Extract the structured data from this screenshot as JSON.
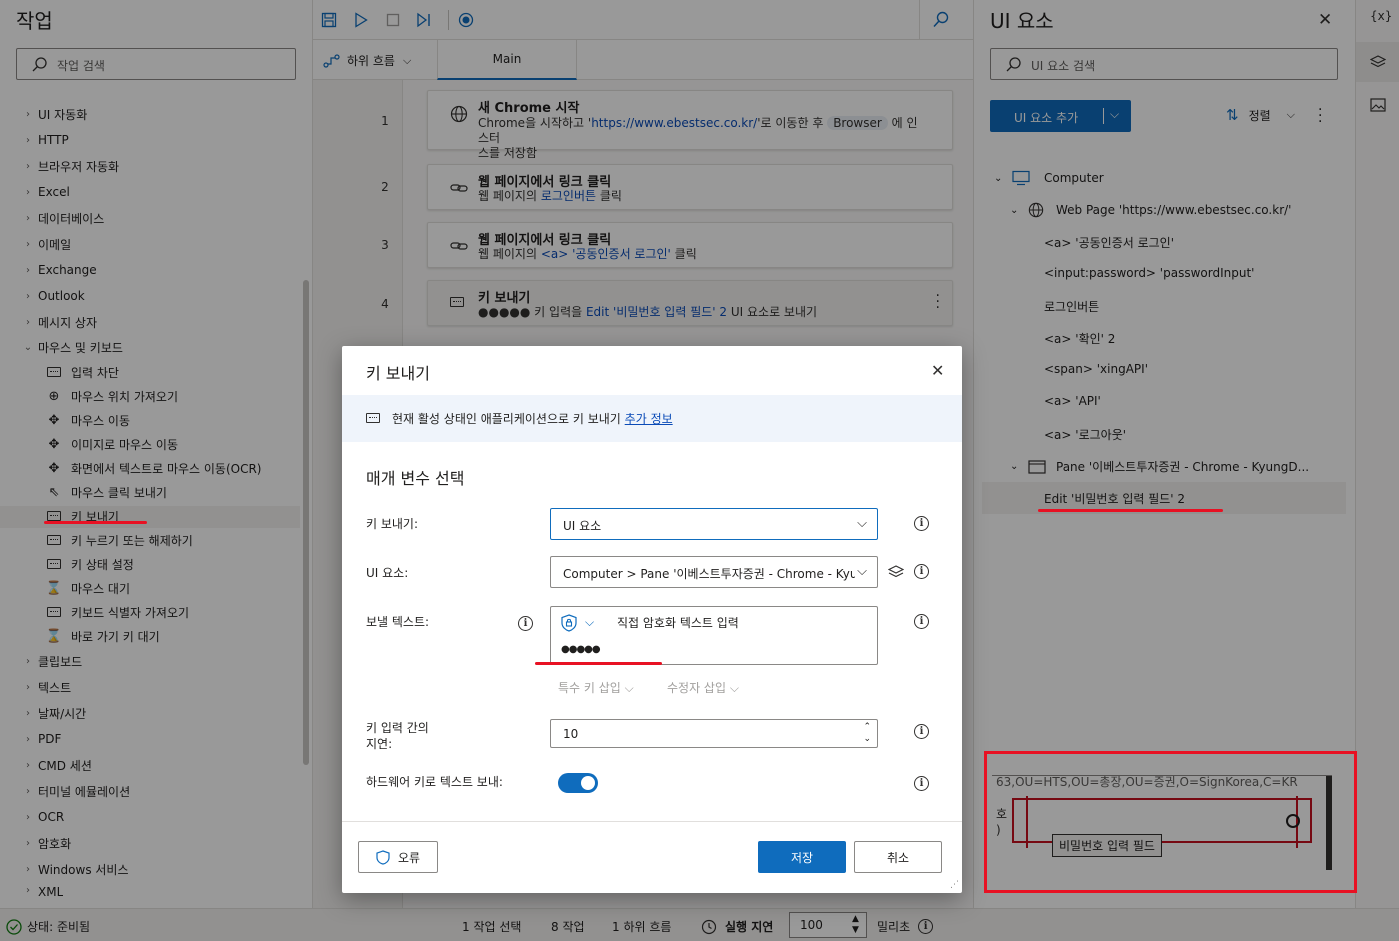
{
  "left_panel": {
    "title": "작업",
    "search_placeholder": "작업 검색",
    "categories_top": [
      "UI 자동화",
      "HTTP",
      "브라우저 자동화",
      "Excel",
      "데이터베이스",
      "이메일",
      "Exchange",
      "Outlook",
      "메시지 상자"
    ],
    "expanded_category": "마우스 및 키보드",
    "sub_items": [
      "입력 차단",
      "마우스 위치 가져오기",
      "마우스 이동",
      "이미지로 마우스 이동",
      "화면에서 텍스트로 마우스 이동(OCR)",
      "마우스 클릭 보내기",
      "키 보내기",
      "키 누르기 또는 해제하기",
      "키 상태 설정",
      "마우스 대기",
      "키보드 식별자 가져오기",
      "바로 가기 키 대기"
    ],
    "categories_bottom": [
      "클립보드",
      "텍스트",
      "날짜/시간",
      "PDF",
      "CMD 세션",
      "터미널 에뮬레이션",
      "OCR",
      "암호화",
      "Windows 서비스",
      "XML"
    ]
  },
  "tabs": {
    "subflow_label": "하위 흐름",
    "main_tab": "Main"
  },
  "actions": [
    {
      "num": "1",
      "title": "새 Chrome 시작",
      "d1": "Chrome을 시작하고 '",
      "url": "https://www.ebestsec.co.kr/",
      "d2": "'로 이동한 후 ",
      "var": "Browser",
      "d3": " 에 인스터",
      "d4": "스를 저장함"
    },
    {
      "num": "2",
      "title": "웹 페이지에서 링크 클릭",
      "d1": "웹 페이지의 ",
      "link": "로그인버튼",
      "d2": " 클릭"
    },
    {
      "num": "3",
      "title": "웹 페이지에서 링크 클릭",
      "d1": "웹 페이지의 ",
      "link": "<a> '공동인증서 로그인'",
      "d2": " 클릭"
    },
    {
      "num": "4",
      "title": "키 보내기",
      "d1": "●●●●● 키 입력을 ",
      "link": "Edit '비밀번호 입력 필드' 2",
      "d2": " UI 요소로 보내기"
    }
  ],
  "right_panel": {
    "title": "UI 요소",
    "search_placeholder": "UI 요소 검색",
    "add_button": "UI 요소 추가",
    "sort_label": "정렬",
    "tree": {
      "computer": "Computer",
      "webpage": "Web Page 'https://www.ebestsec.co.kr/'",
      "web_children": [
        "<a> '공동인증서 로그인'",
        "<input:password> 'passwordInput'",
        "로그인버튼",
        "<a> '확인' 2",
        "<span> 'xingAPI'",
        "<a> 'API'",
        "<a> '로그아웃'"
      ],
      "pane": "Pane '이베스트투자증권 - Chrome - KyungD...",
      "pane_child": "Edit '비밀번호 입력 필드' 2"
    },
    "preview": {
      "top_text": "63,OU=HTS,OU=총장,OU=증권,O=SignKorea,C=KR",
      "left_chars": "호\n)",
      "field_label": "비밀번호 입력 필드"
    }
  },
  "rail": {
    "var_icon": "{x}"
  },
  "status_bar": {
    "status": "상태: 준비됨",
    "selected": "1 작업 선택",
    "actions": "8 작업",
    "subflows": "1 하위 흐름",
    "delay_label": "실행 지연",
    "delay_value": "100",
    "unit": "밀리초"
  },
  "dialog": {
    "title": "키 보내기",
    "info_text": "현재 활성 상태인 애플리케이션으로 키 보내기",
    "info_link": "추가 정보",
    "section": "매개 변수 선택",
    "send_keys_to_label": "키 보내기:",
    "send_keys_to_value": "UI 요소",
    "ui_element_label": "UI 요소:",
    "ui_element_value": "Computer > Pane '이베스트투자증권 - Chrome - Kyung",
    "text_label": "보낼 텍스트:",
    "text_mode": "직접 암호화 텍스트 입력",
    "text_value": "●●●●●",
    "special_key": "특수 키 삽입",
    "modifier": "수정자 삽입",
    "delay_label_1": "키 입력 간의",
    "delay_label_2": "지연:",
    "delay_value": "10",
    "hardware_label": "하드웨어 키로 텍스트 보내:",
    "hardware_on": true,
    "error_button": "오류",
    "save_button": "저장",
    "cancel_button": "취소"
  }
}
